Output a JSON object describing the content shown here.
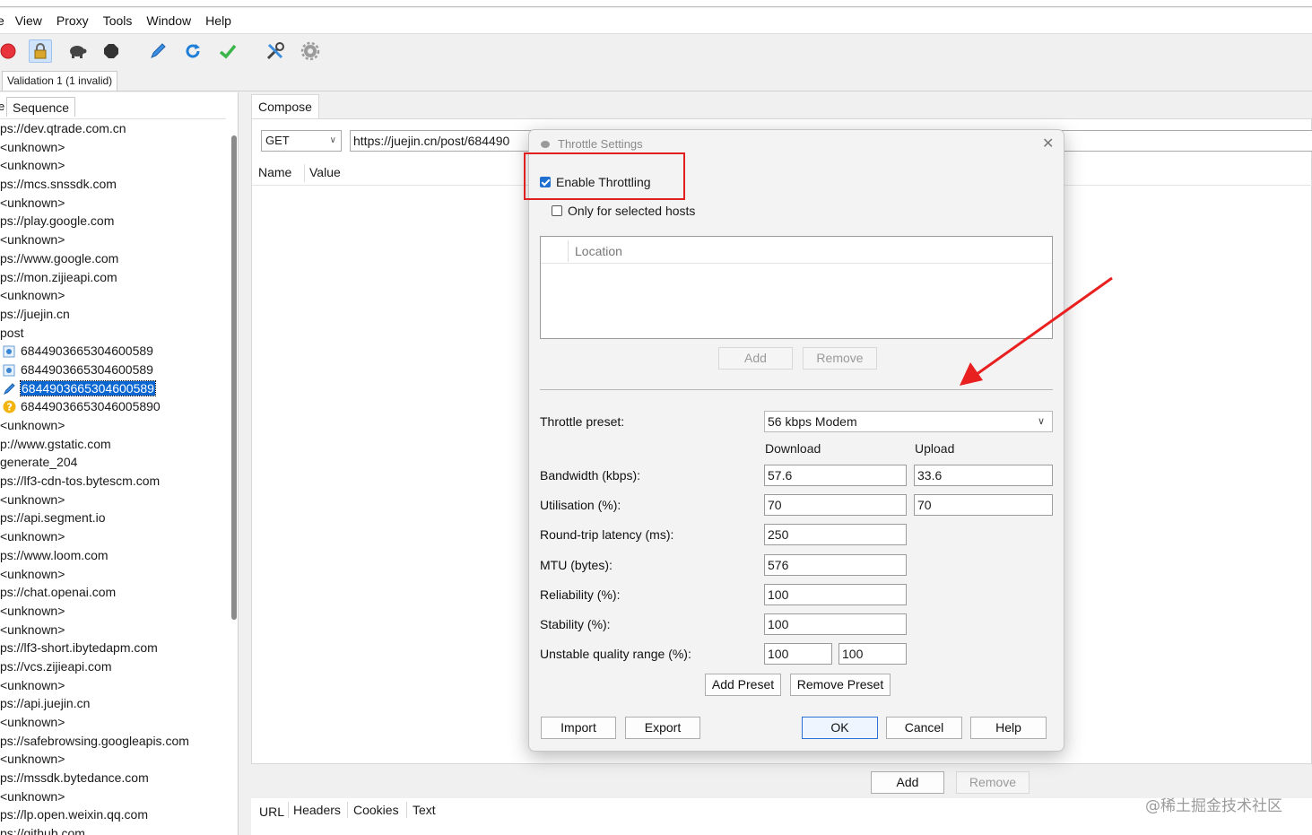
{
  "menu": [
    "View",
    "Proxy",
    "Tools",
    "Window",
    "Help"
  ],
  "menu_edge": "e",
  "top_tab": "Validation 1 (1 invalid)",
  "left": {
    "tab_edge": "e",
    "tab": "Sequence",
    "items": [
      {
        "text": "ps://dev.qtrade.com.cn",
        "icon": ""
      },
      {
        "text": "<unknown>",
        "icon": ""
      },
      {
        "text": "<unknown>",
        "icon": ""
      },
      {
        "text": "ps://mcs.snssdk.com",
        "icon": ""
      },
      {
        "text": "<unknown>",
        "icon": ""
      },
      {
        "text": "ps://play.google.com",
        "icon": ""
      },
      {
        "text": "<unknown>",
        "icon": ""
      },
      {
        "text": "ps://www.google.com",
        "icon": ""
      },
      {
        "text": "ps://mon.zijieapi.com",
        "icon": ""
      },
      {
        "text": "<unknown>",
        "icon": ""
      },
      {
        "text": "ps://juejin.cn",
        "icon": ""
      },
      {
        "text": "post",
        "icon": ""
      },
      {
        "text": "6844903665304600589",
        "icon": "request-icon"
      },
      {
        "text": "6844903665304600589",
        "icon": "request-icon"
      },
      {
        "text": "6844903665304600589",
        "icon": "compose-pen-icon",
        "selected": true
      },
      {
        "text": "68449036653046005890",
        "icon": "question-icon"
      },
      {
        "text": "<unknown>",
        "icon": ""
      },
      {
        "text": "p://www.gstatic.com",
        "icon": ""
      },
      {
        "text": "generate_204",
        "icon": ""
      },
      {
        "text": "ps://lf3-cdn-tos.bytescm.com",
        "icon": ""
      },
      {
        "text": "<unknown>",
        "icon": ""
      },
      {
        "text": "ps://api.segment.io",
        "icon": ""
      },
      {
        "text": "<unknown>",
        "icon": ""
      },
      {
        "text": "ps://www.loom.com",
        "icon": ""
      },
      {
        "text": "<unknown>",
        "icon": ""
      },
      {
        "text": "ps://chat.openai.com",
        "icon": ""
      },
      {
        "text": "<unknown>",
        "icon": ""
      },
      {
        "text": "<unknown>",
        "icon": ""
      },
      {
        "text": "ps://lf3-short.ibytedapm.com",
        "icon": ""
      },
      {
        "text": "ps://vcs.zijieapi.com",
        "icon": ""
      },
      {
        "text": "<unknown>",
        "icon": ""
      },
      {
        "text": "ps://api.juejin.cn",
        "icon": ""
      },
      {
        "text": "<unknown>",
        "icon": ""
      },
      {
        "text": "ps://safebrowsing.googleapis.com",
        "icon": ""
      },
      {
        "text": "<unknown>",
        "icon": ""
      },
      {
        "text": "ps://mssdk.bytedance.com",
        "icon": ""
      },
      {
        "text": "<unknown>",
        "icon": ""
      },
      {
        "text": "ps://lp.open.weixin.qq.com",
        "icon": ""
      },
      {
        "text": "ps://github.com",
        "icon": ""
      }
    ]
  },
  "compose": {
    "tab": "Compose",
    "method": "GET",
    "url": "https://juejin.cn/post/684490",
    "columns": {
      "name": "Name",
      "value": "Value"
    },
    "add": "Add",
    "remove": "Remove",
    "subtabs": [
      "URL",
      "Headers",
      "Cookies",
      "Text"
    ]
  },
  "dialog": {
    "title": "Throttle Settings",
    "enable_throttling": "Enable Throttling",
    "enable_checked": true,
    "only_selected_hosts": "Only for selected hosts",
    "only_checked": false,
    "location_header": "Location",
    "add": "Add",
    "remove": "Remove",
    "preset_label": "Throttle preset:",
    "preset_value": "56 kbps Modem",
    "download": "Download",
    "upload": "Upload",
    "fields": {
      "bandwidth": {
        "label": "Bandwidth (kbps):",
        "down": "57.6",
        "up": "33.6"
      },
      "utilisation": {
        "label": "Utilisation (%):",
        "down": "70",
        "up": "70"
      },
      "latency": {
        "label": "Round-trip latency (ms):",
        "value": "250"
      },
      "mtu": {
        "label": "MTU (bytes):",
        "value": "576"
      },
      "reliability": {
        "label": "Reliability (%):",
        "value": "100"
      },
      "stability": {
        "label": "Stability (%):",
        "value": "100"
      },
      "unstable": {
        "label": "Unstable quality range (%):",
        "min": "100",
        "max": "100"
      }
    },
    "add_preset": "Add Preset",
    "remove_preset": "Remove Preset",
    "import": "Import",
    "export": "Export",
    "ok": "OK",
    "cancel": "Cancel",
    "help": "Help"
  },
  "watermark": "@稀土掘金技术社区",
  "colors": {
    "accent": "#1f6fd1",
    "selection": "#0a66d0",
    "annotation": "#e02020"
  }
}
